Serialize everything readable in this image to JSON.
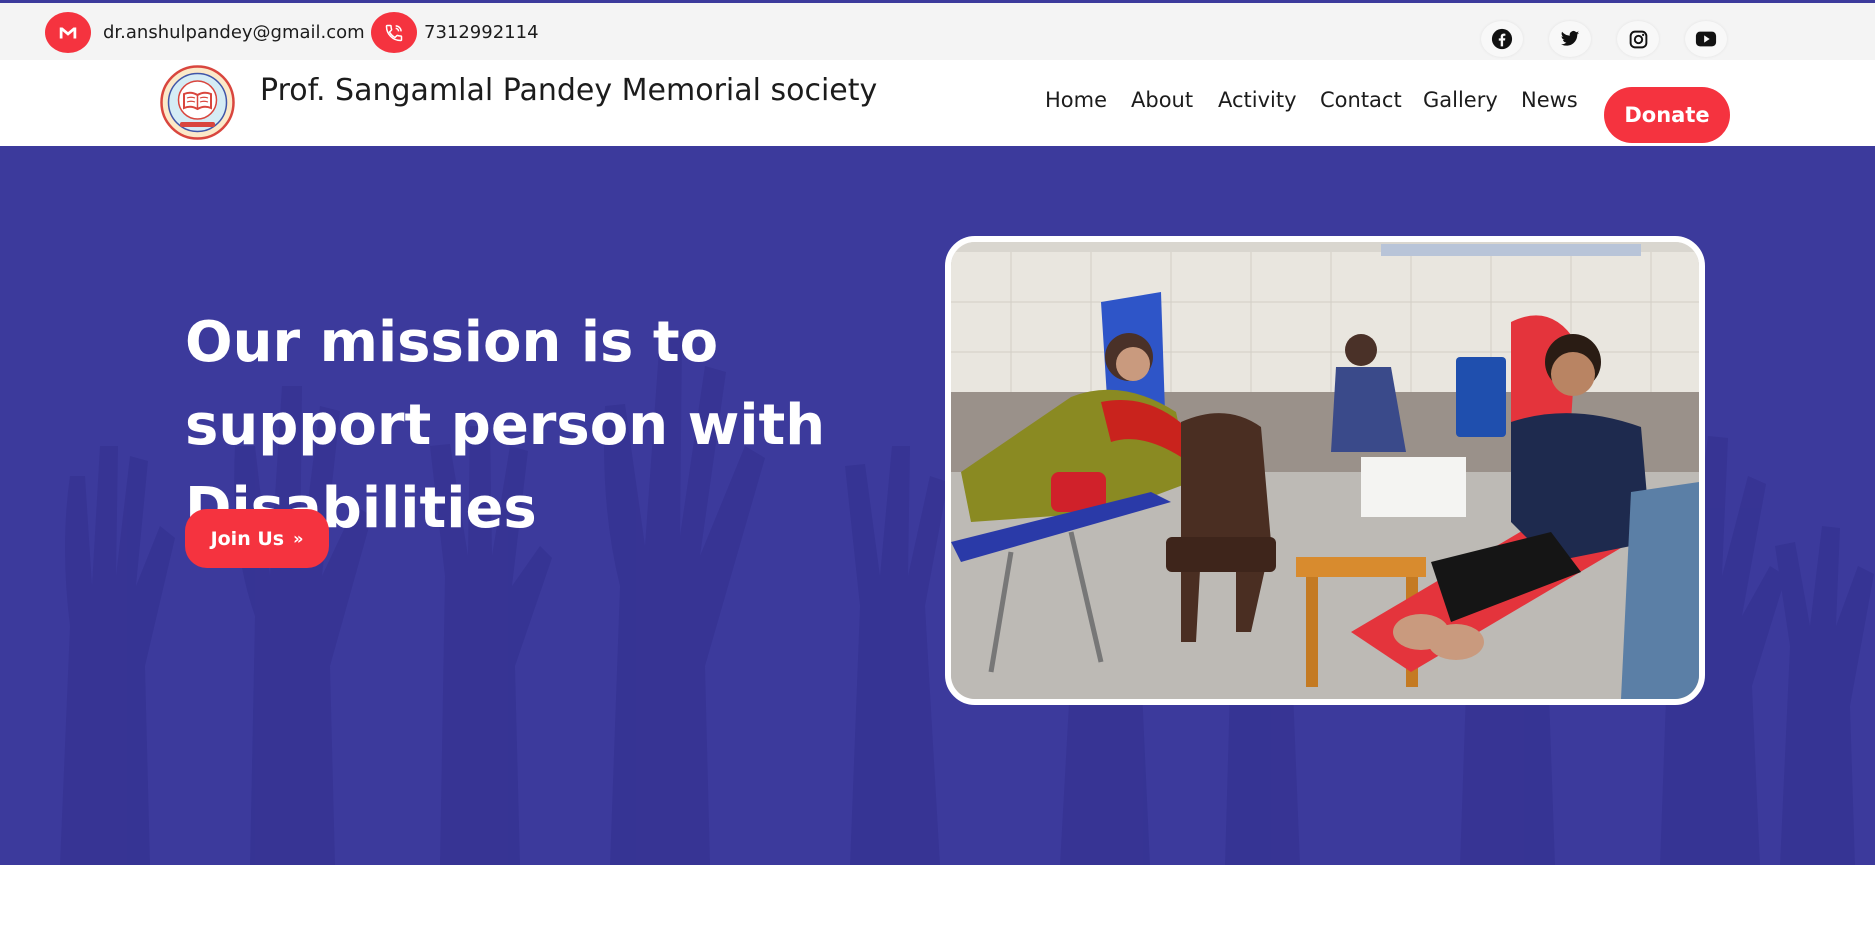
{
  "contact": {
    "email": "dr.anshulpandey@gmail.com",
    "email_icon": "gmail-icon",
    "phone": "7312992114",
    "phone_icon": "phone-icon"
  },
  "social": [
    {
      "name": "facebook-icon"
    },
    {
      "name": "twitter-icon"
    },
    {
      "name": "instagram-icon"
    },
    {
      "name": "youtube-icon"
    }
  ],
  "header": {
    "title": "Prof. Sangamlal Pandey Memorial society",
    "nav": [
      "Home",
      "About",
      "Activity",
      "Contact",
      "Gallery",
      "News"
    ],
    "donate_label": "Donate"
  },
  "hero": {
    "headline": "Our mission is to support person with Disabilities",
    "join_label": "Join Us",
    "join_icon": "double-chevron-right-icon",
    "image_alt": "blood donation camp"
  },
  "colors": {
    "primary": "#3c3a9c",
    "accent": "#f5333f",
    "text": "#1c1c1c",
    "topbar": "#f4f4f4"
  }
}
